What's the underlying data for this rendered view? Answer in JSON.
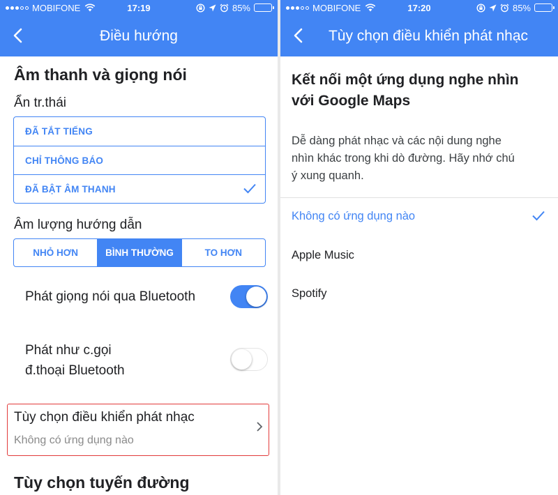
{
  "left": {
    "status": {
      "carrier": "MOBIFONE",
      "time": "17:19",
      "battery": "85%"
    },
    "appbar": {
      "title": "Điều hướng"
    },
    "sound_section": {
      "heading": "Âm thanh và giọng nói",
      "mute_label": "Ẩn tr.thái",
      "mute_options": [
        {
          "label": "ĐÃ TẮT TIẾNG",
          "selected": false
        },
        {
          "label": "CHỈ THÔNG BÁO",
          "selected": false
        },
        {
          "label": "ĐÃ BẬT ÂM THANH",
          "selected": true
        }
      ],
      "volume_label": "Âm lượng hướng dẫn",
      "volume_options": [
        {
          "label": "NHỎ HƠN",
          "selected": false
        },
        {
          "label": "BÌNH THƯỜNG",
          "selected": true
        },
        {
          "label": "TO HƠN",
          "selected": false
        }
      ],
      "bluetooth_voice": {
        "label": "Phát giọng nói qua Bluetooth",
        "on": true
      },
      "bluetooth_call": {
        "label_line1": "Phát như c.gọi",
        "label_line2": "đ.thoại Bluetooth",
        "on": false
      },
      "music_controls": {
        "title": "Tùy chọn điều khiển phát nhạc",
        "subtitle": "Không có ứng dụng nào"
      }
    },
    "route_section": {
      "heading": "Tùy chọn tuyến đường"
    }
  },
  "right": {
    "status": {
      "carrier": "MOBIFONE",
      "time": "17:20",
      "battery": "85%"
    },
    "appbar": {
      "title": "Tùy chọn điều khiển phát nhạc"
    },
    "heading_line1": "Kết nối một ứng dụng nghe nhìn",
    "heading_line2": "với Google Maps",
    "desc_line1": "Dễ dàng phát nhạc và các nội dung nghe",
    "desc_line2": "nhìn khác trong khi dò đường. Hãy nhớ chú",
    "desc_line3": "ý xung quanh.",
    "apps": [
      {
        "label": "Không có ứng dụng nào",
        "selected": true
      },
      {
        "label": "Apple Music",
        "selected": false
      },
      {
        "label": "Spotify",
        "selected": false
      }
    ]
  },
  "colors": {
    "accent": "#4285f4",
    "highlight_border": "#e23a3a"
  },
  "battery_level": 0.85
}
